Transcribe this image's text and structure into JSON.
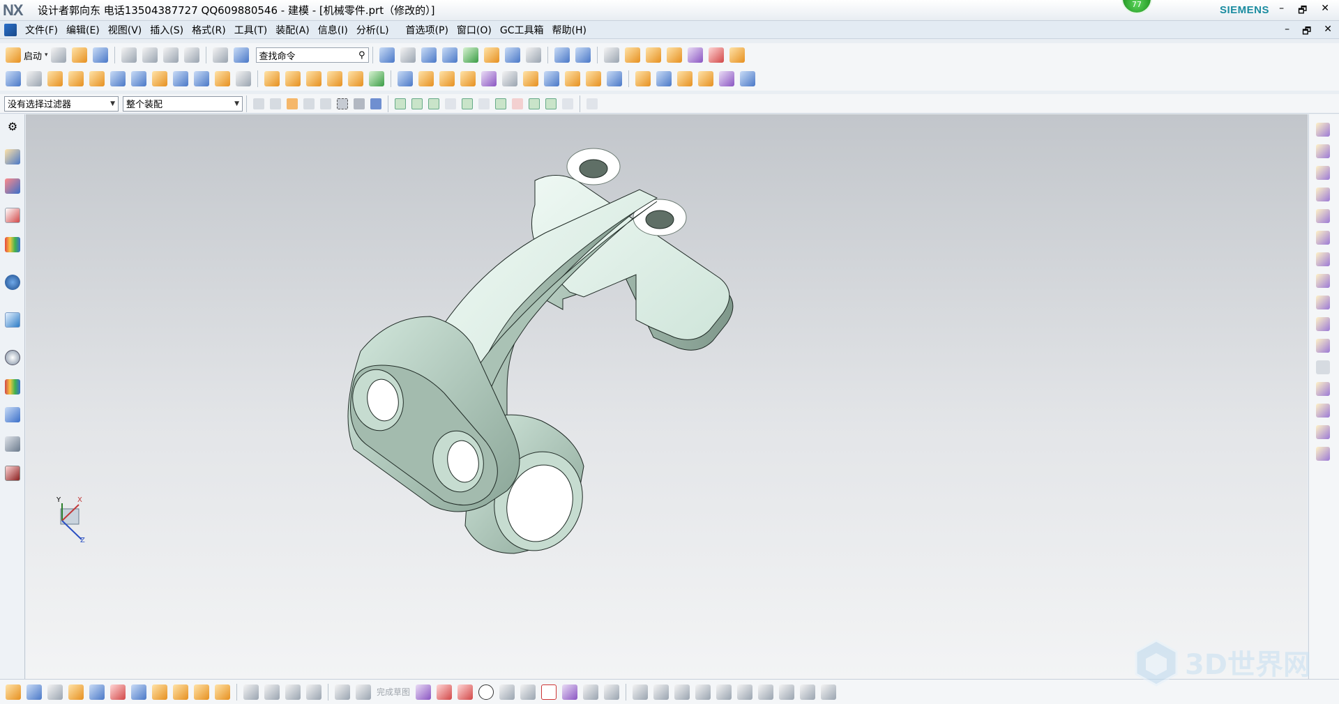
{
  "titlebar": {
    "logo": "NX",
    "title": "设计者郭向东  电话13504387727  QQ609880546 - 建模 - [机械零件.prt（修改的）]",
    "brand": "SIEMENS",
    "badge": "77",
    "controls": [
      "–",
      "🗗",
      "✕"
    ]
  },
  "menubar": {
    "items": [
      "文件(F)",
      "编辑(E)",
      "视图(V)",
      "插入(S)",
      "格式(R)",
      "工具(T)",
      "装配(A)",
      "信息(I)",
      "分析(L)",
      "首选项(P)",
      "窗口(O)",
      "GC工具箱",
      "帮助(H)"
    ],
    "controls": [
      "–",
      "🗗",
      "✕"
    ]
  },
  "toolbar1": {
    "start_label": "启动",
    "search_placeholder": "查找命令"
  },
  "toolbar3": {
    "filter_value": "没有选择过滤器",
    "assembly_value": "整个装配"
  },
  "bottombar": {
    "finish_sketch": "完成草图"
  },
  "axis": {
    "x": "X",
    "y": "Y",
    "z": "Z"
  },
  "watermark": {
    "text": "3D世界网"
  },
  "colors": {
    "part_face": "#d8ece2",
    "part_side": "#9fb7aa",
    "brand": "#1a8ca0"
  }
}
